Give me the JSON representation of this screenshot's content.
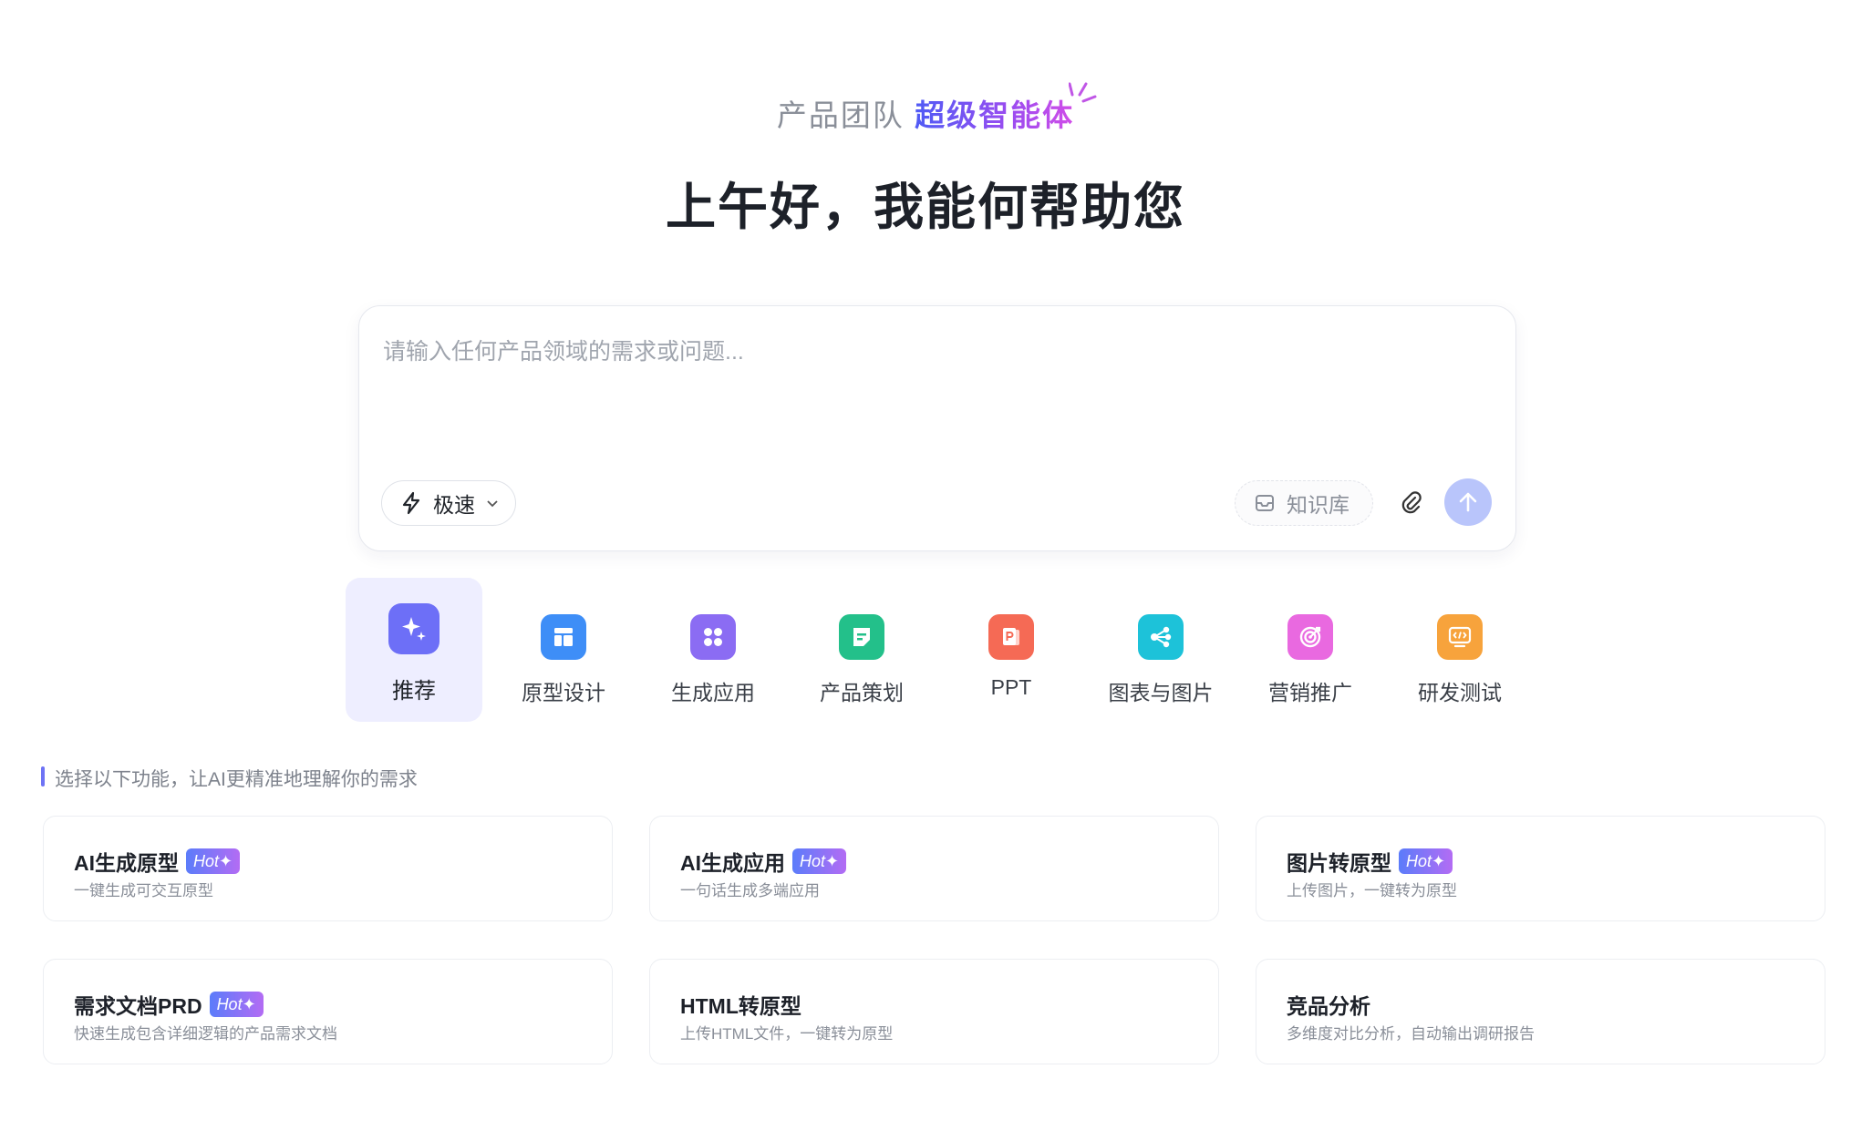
{
  "header": {
    "subtitle_muted": "产品团队",
    "subtitle_accent": "超级智能体",
    "greeting": "上午好，我能何帮助您"
  },
  "prompt": {
    "placeholder": "请输入任何产品领域的需求或问题...",
    "mode_label": "极速",
    "knowledge_label": "知识库"
  },
  "tabs": [
    {
      "label": "推荐",
      "icon": "sparkle-icon",
      "color": "#6d6ff7",
      "active": true
    },
    {
      "label": "原型设计",
      "icon": "layout-icon",
      "color": "#3e8ef7"
    },
    {
      "label": "生成应用",
      "icon": "apps-grid-icon",
      "color": "#8b6cf3"
    },
    {
      "label": "产品策划",
      "icon": "document-icon",
      "color": "#23c08a"
    },
    {
      "label": "PPT",
      "icon": "ppt-icon",
      "color": "#f56a55"
    },
    {
      "label": "图表与图片",
      "icon": "share-nodes-icon",
      "color": "#1dc2d9"
    },
    {
      "label": "营销推广",
      "icon": "target-icon",
      "color": "#e969e0"
    },
    {
      "label": "研发测试",
      "icon": "code-icon",
      "color": "#f7a33c"
    }
  ],
  "section": {
    "hint": "选择以下功能，让AI更精准地理解你的需求"
  },
  "cards": [
    {
      "title": "AI生成原型",
      "hot": "Hot",
      "desc": "一键生成可交互原型"
    },
    {
      "title": "AI生成应用",
      "hot": "Hot",
      "desc": "一句话生成多端应用"
    },
    {
      "title": "图片转原型",
      "hot": "Hot",
      "desc": "上传图片，一键转为原型"
    },
    {
      "title": "需求文档PRD",
      "hot": "Hot",
      "desc": "快速生成包含详细逻辑的产品需求文档"
    },
    {
      "title": "HTML转原型",
      "hot": "",
      "desc": "上传HTML文件，一键转为原型"
    },
    {
      "title": "竞品分析",
      "hot": "",
      "desc": "多维度对比分析，自动输出调研报告"
    }
  ]
}
